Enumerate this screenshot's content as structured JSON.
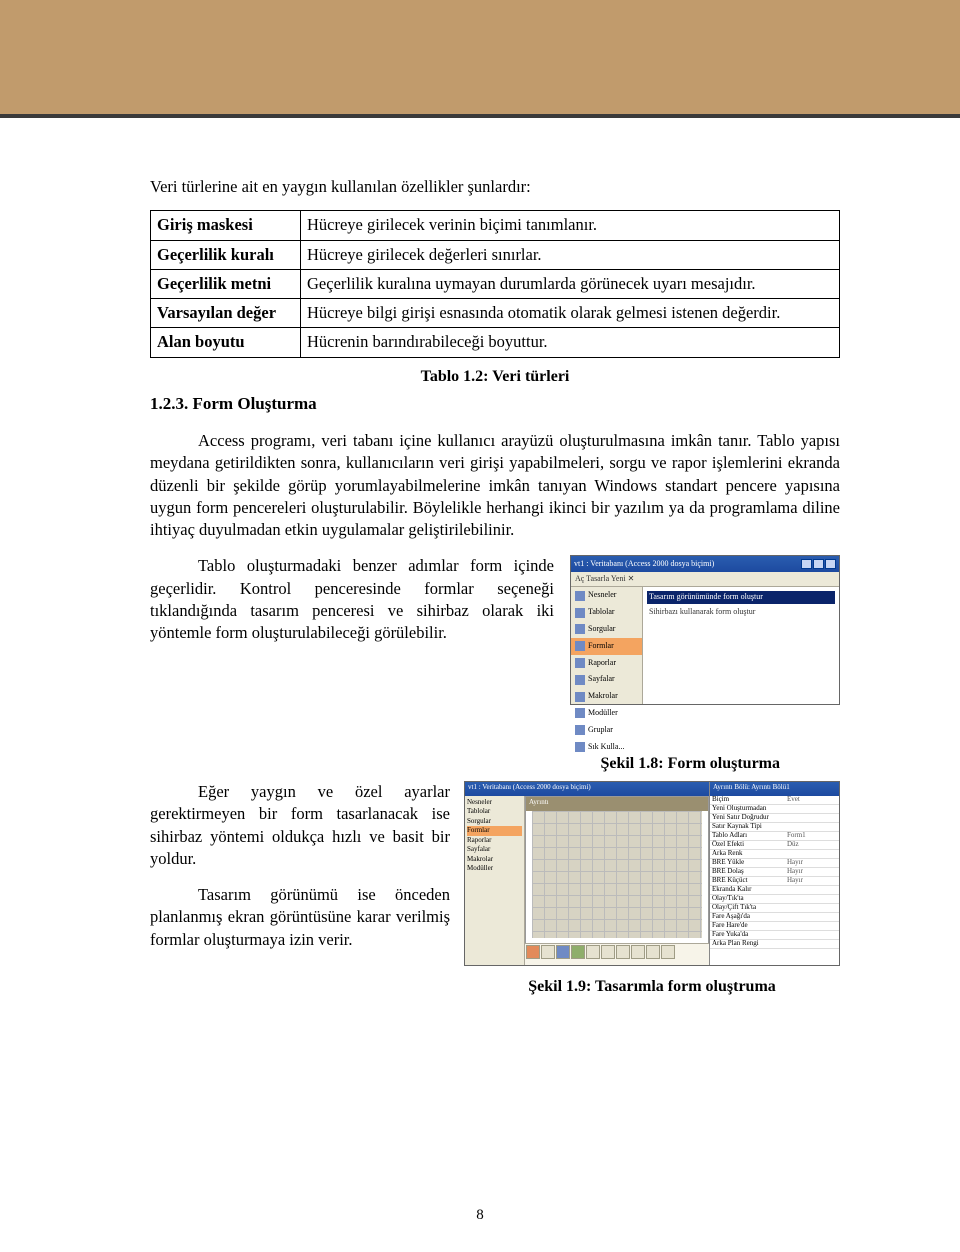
{
  "intro": "Veri türlerine ait en yaygın kullanılan özellikler şunlardır:",
  "table": [
    {
      "name": "Giriş maskesi",
      "desc": "Hücreye girilecek verinin biçimi tanımlanır."
    },
    {
      "name": "Geçerlilik kuralı",
      "desc": "Hücreye girilecek değerleri sınırlar."
    },
    {
      "name": "Geçerlilik metni",
      "desc": "Geçerlilik kuralına uymayan durumlarda görünecek uyarı mesajıdır."
    },
    {
      "name": "Varsayılan değer",
      "desc": "Hücreye bilgi girişi esnasında otomatik olarak gelmesi istenen değerdir."
    },
    {
      "name": "Alan boyutu",
      "desc": "Hücrenin barındırabileceği boyuttur."
    }
  ],
  "table_caption": "Tablo 1.2: Veri türleri",
  "heading": "1.2.3. Form Oluşturma",
  "para1": "Access programı, veri tabanı içine kullanıcı arayüzü oluşturulmasına imkân tanır. Tablo yapısı meydana getirildikten sonra, kullanıcıların veri girişi yapabilmeleri, sorgu ve rapor işlemlerini ekranda düzenli bir şekilde görüp yorumlayabilmelerine imkân tanıyan Windows standart pencere yapısına uygun form pencereleri oluşturulabilir. Böylelikle herhangi ikinci bir yazılım ya da programlama diline ihtiyaç duyulmadan etkin uygulamalar geliştirilebilinir.",
  "para2": "Tablo oluşturmadaki benzer adımlar form içinde geçerlidir. Kontrol penceresinde formlar seçeneği tıklandığında tasarım penceresi ve sihirbaz olarak iki yöntemle form oluşturulabileceği görülebilir.",
  "fig1": {
    "title": "vt1 : Veritabanı (Access 2000 dosya biçimi)",
    "toolbar": "Aç  Tasarla  Yeni  ✕",
    "nav": [
      "Nesneler",
      "Tablolar",
      "Sorgular",
      "Formlar",
      "Raporlar",
      "Sayfalar",
      "Makrolar",
      "Modüller",
      "Gruplar",
      "Sık Kulla..."
    ],
    "selected": "Formlar",
    "opts": [
      "Tasarım görünümünde form oluştur",
      "Sihirbazı kullanarak form oluştur"
    ],
    "caption": "Şekil 1.8: Form oluşturma"
  },
  "para3": "Eğer yaygın ve özel ayarlar gerektirmeyen bir form tasarlanacak ise sihirbaz yöntemi oldukça hızlı ve basit bir yoldur.",
  "para4": "Tasarım görünümü ise önceden planlanmış ekran görüntüsüne karar verilmiş formlar oluşturmaya izin verir.",
  "fig2": {
    "winTitle": "vt1 : Veritabanı (Access 2000 dosya biçimi)",
    "detailHeader": "Ayrıntı",
    "propTitle": "Ayrıntı Bölü: Ayrıntı Bölü1",
    "caption": "Şekil 1.9: Tasarımla form oluştruma",
    "props": [
      [
        "Biçim",
        "Evet"
      ],
      [
        "Yeni Oluşturmadan",
        ""
      ],
      [
        "Yeni Satır Doğrudur",
        ""
      ],
      [
        "Satır Kaynak Tipi",
        ""
      ],
      [
        "Tablo Adları",
        "Form1"
      ],
      [
        "Özel Efekti",
        "Düz"
      ],
      [
        "Arka Renk",
        ""
      ],
      [
        "BRE Yükle",
        "Hayır"
      ],
      [
        "BRE Dolaş",
        "Hayır"
      ],
      [
        "BRE Küçüct",
        "Hayır"
      ],
      [
        "Ekranda Kalır",
        ""
      ],
      [
        "Olay/Tık'ta",
        ""
      ],
      [
        "Olay/Çift Tık'ta",
        ""
      ],
      [
        "Fare Aşağı'da",
        ""
      ],
      [
        "Fare Hare'de",
        ""
      ],
      [
        "Fare Yuka'da",
        ""
      ],
      [
        "Arka Plan Rengi",
        ""
      ]
    ]
  },
  "page": "8"
}
